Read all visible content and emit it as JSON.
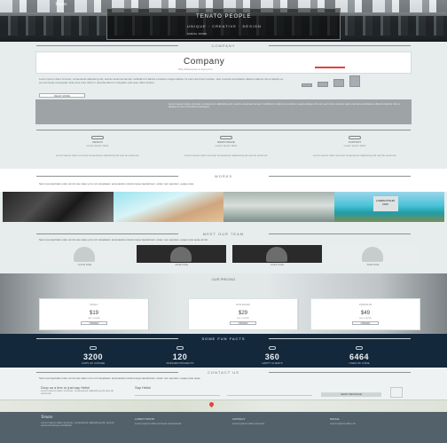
{
  "hero": {
    "logo": "Tenato",
    "brand_line1": "TENATO PEOPLE",
    "brand_line2": "UNIQUE · CREATIVE · DESIGN",
    "brand_line3": "SCROLL DOWN"
  },
  "company": {
    "section_label": "COMPANY",
    "banner_title": "Company",
    "banner_subtitle": "Why Businesses & Everyone",
    "text": "Lorem ipsum dolor sit amet, consectetur adipiscing elit, sed do eiusmod tempor incididunt ut labore et dolore magna aliqua. Ut enim ad minim veniam, quis nostrud exercitation ullamco laboris nisi ut aliquip ex ea commodo consequat. Duis aute irure dolor in reprehenderit in voluptate velit esse cillum dolore.",
    "button_label": "READ MORE",
    "bar_levels": [
      0.3,
      0.45,
      0.65,
      0.95
    ],
    "panel_text": "Lorem ipsum dolor sit amet, consectetur adipiscing elit, sed do eiusmod tempor incididunt ut labore et dolore magna aliqua. Ut enim ad minim veniam quis nostrud exercitation ullamco laboris nisi ut aliquip ex ea commodo consequat."
  },
  "services": [
    {
      "title": "DESIGN",
      "sub": "Lorem ipsum dolor",
      "title2": "DESIGN",
      "desc": "Lorem ipsum dolor sit amet consectetur adipiscing elit sed do eiusmod."
    },
    {
      "title": "RESPONSIVE",
      "sub": "Lorem ipsum dolor",
      "title2": "CREATIVE",
      "desc": "Lorem ipsum dolor sit amet consectetur adipiscing elit sed do eiusmod."
    },
    {
      "title": "SUPPORT",
      "sub": "Lorem ipsum dolor",
      "title2": "HARD WORK",
      "desc": "Lorem ipsum dolor sit amet consectetur adipiscing elit sed do eiusmod."
    }
  ],
  "works": {
    "section_label": "WORKS",
    "intro": "Sed ut perspiciatis unde omnis iste natus error sit voluptatem accusantium doloremque laudantium, totam rem aperiam, eaque ipsa.",
    "photo4_badge": "LOREM IPSUM 2016"
  },
  "team": {
    "section_label": "MEET OUR TEAM",
    "intro": "Sed ut perspiciatis unde omnis iste natus error sit voluptatem accusantium doloremque laudantium, totam rem aperiam, eaque ipsa quae ab illo.",
    "members": [
      {
        "caption": "JOHN DOE"
      },
      {
        "caption": "JANE DOE"
      },
      {
        "caption": "ALEX DOE"
      },
      {
        "caption": "SAM DOE"
      }
    ]
  },
  "pricing": {
    "section_label": "OUR PRICING",
    "subtitle": "Choose a payment plan that works for you",
    "plans": [
      {
        "name": "BASIC",
        "amount": "$19",
        "per": "per month",
        "button": "ORDER"
      },
      {
        "name": "STANDARD",
        "amount": "$29",
        "per": "per month",
        "button": "ORDER"
      },
      {
        "name": "PREMIUM",
        "amount": "$49",
        "per": "per month",
        "button": "ORDER"
      }
    ]
  },
  "facts": {
    "section_label": "SOME FUN FACTS",
    "items": [
      {
        "number": "3200",
        "label": "CUPS OF COFFEE"
      },
      {
        "number": "120",
        "label": "FINISHED PROJECTS"
      },
      {
        "number": "360",
        "label": "HAPPY CLIENTS"
      },
      {
        "number": "6464",
        "label": "LINES OF CODE"
      }
    ]
  },
  "contact": {
    "section_label": "CONTACT US",
    "intro": "Sed ut perspiciatis unde omnis iste natus error sit voluptatem accusantium doloremque laudantium, totam rem aperiam, eaque ipsa quae.",
    "col1_title": "Drop us a line or just say Hello!",
    "col1_text": "Lorem ipsum dolor sit amet, consectetur adipiscing elit sed do eiusmod.",
    "col2_title": "Say Hello!",
    "send_label": "SEND MESSAGE"
  },
  "footer": {
    "logo": "Tenato",
    "about": "Lorem ipsum dolor sit amet, consectetur adipiscing elit, sed do eiusmod tempor incididunt.",
    "col2_title": "LATEST POSTS",
    "col2_text": "Lorem ipsum dolor sit amet consectetur",
    "col3_title": "CONTACT",
    "col3_text": "Lorem ipsum dolor sit amet",
    "col4_title": "SOCIAL",
    "col4_text": "Lorem ipsum dolor sit"
  },
  "colors": {
    "accent": "#e2433d",
    "facts_bg": "#14283c",
    "footer_bg": "#53616a",
    "page_bg": "#e7eded"
  }
}
